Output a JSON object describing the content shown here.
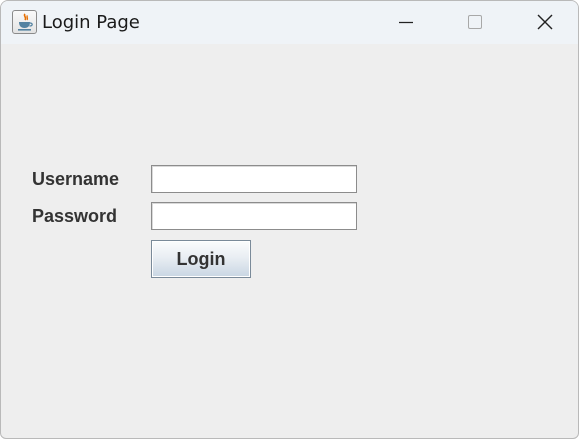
{
  "window": {
    "title": "Login Page",
    "icon": "java-cup-icon",
    "controls": [
      "minimize-icon",
      "maximize-icon",
      "close-icon"
    ]
  },
  "form": {
    "username_label": "Username",
    "username_value": "",
    "password_label": "Password",
    "password_value": "",
    "login_label": "Login"
  },
  "colors": {
    "window_bg": "#eeeeee",
    "titlebar_bg": "#eff3f7",
    "label_text": "#333333",
    "java_cup_orange": "#e76f00",
    "java_cup_blue": "#5382a1"
  }
}
